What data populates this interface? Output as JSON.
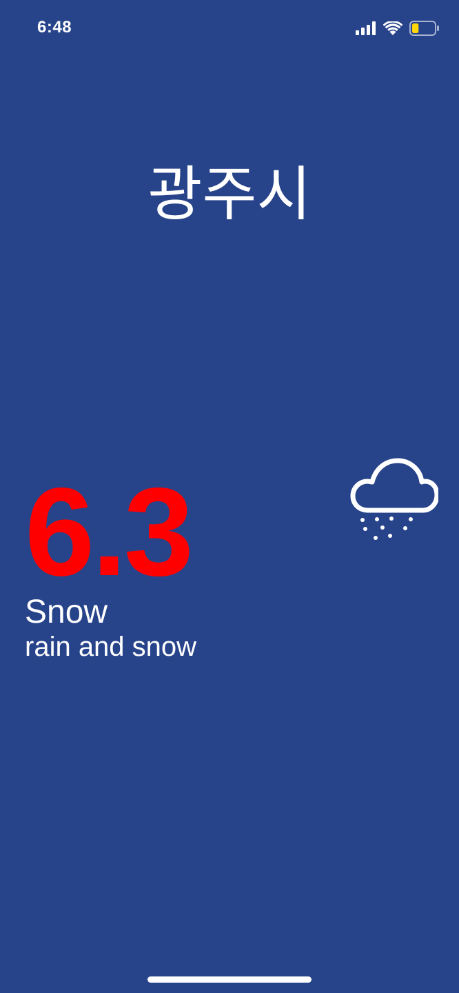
{
  "colors": {
    "background": "#27438a",
    "text": "#ffffff",
    "temperature": "#ff0000",
    "battery_fill": "#ffd60a",
    "home_indicator": "#ffffff"
  },
  "status_bar": {
    "time": "6:48",
    "icons": [
      "cellular-signal-icon",
      "wifi-icon",
      "battery-icon"
    ],
    "battery_level": 0.3
  },
  "city": "광주시",
  "weather": {
    "temperature": "6.3",
    "condition": "Snow",
    "description": "rain and snow",
    "icon": "cloud-snow-icon"
  }
}
